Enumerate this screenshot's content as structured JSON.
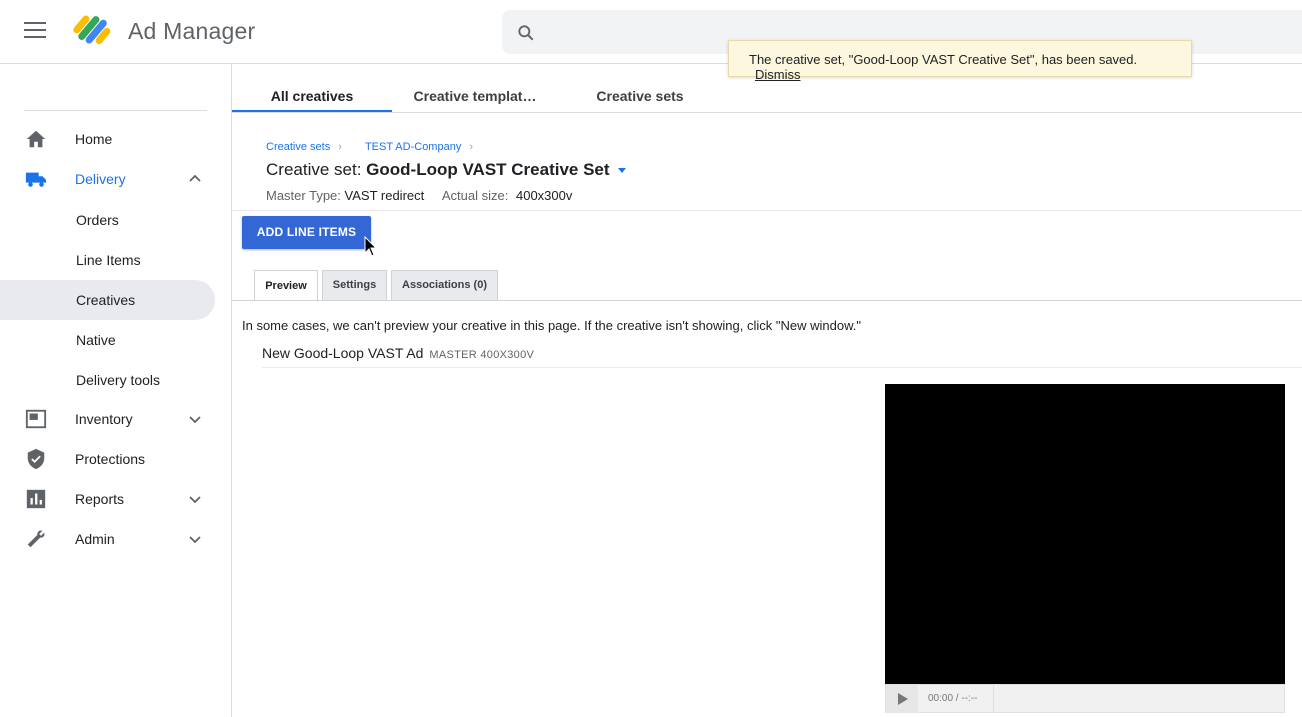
{
  "app": {
    "title": "Ad Manager"
  },
  "toast": {
    "message": "The creative set, \"Good-Loop VAST Creative Set\", has been saved.",
    "dismiss": "Dismiss"
  },
  "sidebar": {
    "items": [
      {
        "label": "Home",
        "icon": "home-icon"
      },
      {
        "label": "Delivery",
        "icon": "truck-icon"
      },
      {
        "label": "Orders"
      },
      {
        "label": "Line Items"
      },
      {
        "label": "Creatives"
      },
      {
        "label": "Native"
      },
      {
        "label": "Delivery tools"
      },
      {
        "label": "Inventory",
        "icon": "inventory-icon"
      },
      {
        "label": "Protections",
        "icon": "shield-icon"
      },
      {
        "label": "Reports",
        "icon": "bar-chart-icon"
      },
      {
        "label": "Admin",
        "icon": "wrench-icon"
      }
    ]
  },
  "tabs": [
    {
      "label": "All creatives"
    },
    {
      "label": "Creative templat…"
    },
    {
      "label": "Creative sets"
    }
  ],
  "breadcrumb": [
    "Creative sets",
    "TEST AD-Company"
  ],
  "creative_set": {
    "prefix": "Creative set:",
    "name": "Good-Loop VAST Creative Set",
    "master_type_label": "Master Type:",
    "master_type": "VAST redirect",
    "actual_size_label": "Actual size:",
    "actual_size": "400x300v"
  },
  "add_button": "ADD LINE ITEMS",
  "sub_tabs": [
    "Preview",
    "Settings",
    "Associations (0)"
  ],
  "preview": {
    "info": "In some cases, we can't preview your creative in this page. If the creative isn't showing, click \"New window.\"",
    "ad_name": "New Good-Loop VAST Ad",
    "ad_tag": "MASTER 400X300V",
    "time": "00:00 / --:--"
  },
  "colors": {
    "accent": "#1a73e8",
    "button": "#3367d6",
    "toast_bg": "#fef7e0"
  }
}
